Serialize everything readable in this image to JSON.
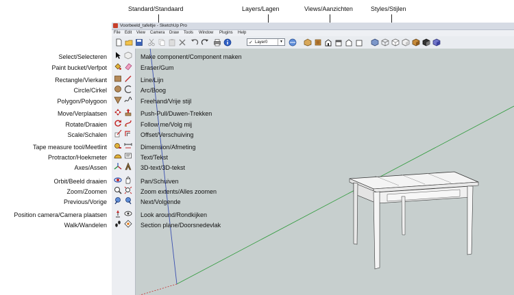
{
  "callouts": {
    "standard": "Standard/Standaard",
    "layers": "Layers/Lagen",
    "views": "Views/Aanzichten",
    "styles": "Styles/Stijlen"
  },
  "window": {
    "title": "Voorbeeld_tafeltje - SketchUp Pro",
    "menu": [
      "File",
      "Edit",
      "View",
      "Camera",
      "Draw",
      "Tools",
      "Window",
      "Plugins",
      "Help"
    ],
    "layer_value": "Layer0"
  },
  "left_labels": [
    "Select/Selecteren",
    "Paint bucket/Verfpot",
    "Rectangle/Vierkant",
    "Circle/Cirkel",
    "Polygon/Polygoon",
    "Move/Verplaatsen",
    "Rotate/Draaien",
    "Scale/Schalen",
    "Tape measure tool/Meetlint",
    "Protractor/Hoekmeter",
    "Axes/Assen",
    "Orbit/Beeld draaien",
    "Zoom/Zoomen",
    "Previous/Vorige",
    "Position camera/Camera plaatsen",
    "Walk/Wandelen"
  ],
  "right_labels": [
    "Make component/Component maken",
    "Eraser/Gum",
    "Line/Lijn",
    "Arc/Boog",
    "Freehand/Vrije stijl",
    "Push-Pull/Duwen-Trekken",
    "Follow me/Volg mij",
    "Offset/Verschuiving",
    "Dimension/Afmeting",
    "Text/Tekst",
    "3D-text/3D-tekst",
    "Pan/Schuiven",
    "Zoom extents/Alles zoomen",
    "Next/Volgende",
    "Look around/Rondkijken",
    "Section plane/Doorsnedevlak"
  ],
  "colors": {
    "viewport": "#c7cfce",
    "axis_green": "#2e9a3a",
    "axis_blue": "#3a4fb0",
    "table_top": "#f4f4f4"
  }
}
